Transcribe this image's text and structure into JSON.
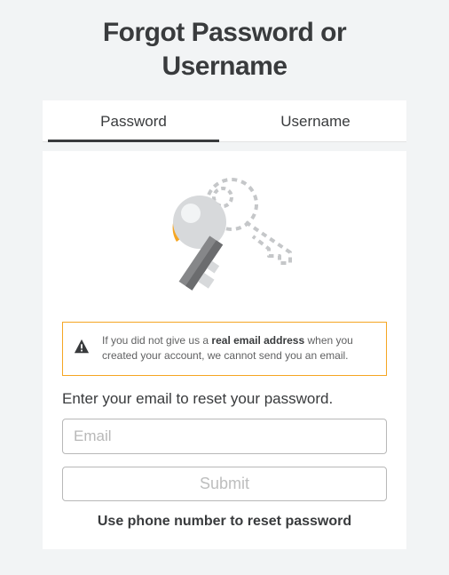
{
  "title": "Forgot Password or Username",
  "tabs": {
    "password": "Password",
    "username": "Username"
  },
  "warning": {
    "pre": "If you did not give us a ",
    "bold": "real email address",
    "post": " when you created your account, we cannot send you an email."
  },
  "instruction": "Enter your email to reset your password.",
  "email_placeholder": "Email",
  "submit_label": "Submit",
  "phone_link": "Use phone number to reset password"
}
